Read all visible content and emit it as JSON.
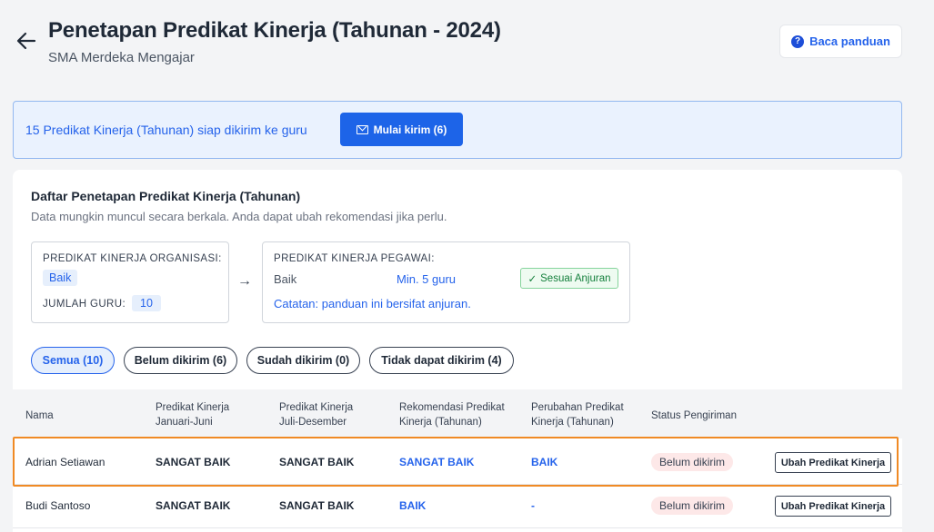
{
  "header": {
    "title": "Penetapan Predikat Kinerja (Tahunan - 2024)",
    "subtitle": "SMA Merdeka Mengajar",
    "guide_label": "Baca panduan",
    "guide_icon": "question-circle-icon",
    "back_icon": "arrow-left-icon"
  },
  "banner": {
    "text": "15 Predikat Kinerja (Tahunan) siap dikirim ke guru",
    "send_label": "Mulai kirim (6)",
    "send_icon": "mail-icon"
  },
  "card": {
    "title": "Daftar Penetapan Predikat Kinerja (Tahunan)",
    "description": "Data mungkin muncul secara berkala. Anda dapat ubah rekomendasi jika perlu.",
    "org": {
      "label": "PREDIKAT KINERJA ORGANISASI:",
      "value": "Baik",
      "teacher_count_label": "JUMLAH GURU:",
      "teacher_count": "10"
    },
    "pegawai": {
      "label": "PREDIKAT KINERJA PEGAWAI:",
      "value": "Baik",
      "min": "Min. 5 guru",
      "badge": "Sesuai Anjuran",
      "badge_icon": "check-icon",
      "note": "Catatan: panduan ini bersifat anjuran."
    }
  },
  "filters": [
    {
      "label": "Semua (10)",
      "active": true
    },
    {
      "label": "Belum dikirim (6)",
      "active": false
    },
    {
      "label": "Sudah dikirim (0)",
      "active": false
    },
    {
      "label": "Tidak dapat dikirim (4)",
      "active": false
    }
  ],
  "table": {
    "headers": [
      [
        "Nama"
      ],
      [
        "Predikat Kinerja",
        "Januari-Juni"
      ],
      [
        "Predikat Kinerja",
        "Juli-Desember"
      ],
      [
        "Rekomendasi Predikat",
        "Kinerja (Tahunan)"
      ],
      [
        "Perubahan Predikat",
        "Kinerja (Tahunan)"
      ],
      [
        "Status Pengiriman"
      ]
    ],
    "rows": [
      {
        "name": "Adrian Setiawan",
        "jan_jun": "SANGAT BAIK",
        "jul_des": "SANGAT BAIK",
        "rekomendasi": "SANGAT BAIK",
        "perubahan": "BAIK",
        "status": "Belum dikirim",
        "action": "Ubah Predikat Kinerja",
        "highlighted": true
      },
      {
        "name": "Budi Santoso",
        "jan_jun": "SANGAT BAIK",
        "jul_des": "SANGAT BAIK",
        "rekomendasi": "BAIK",
        "perubahan": "-",
        "status": "Belum dikirim",
        "action": "Ubah Predikat Kinerja",
        "highlighted": false
      }
    ]
  },
  "colors": {
    "accent": "#1d64e8",
    "highlight": "#f08a24",
    "status_bg": "#fde8e8",
    "success": "#15803d"
  }
}
